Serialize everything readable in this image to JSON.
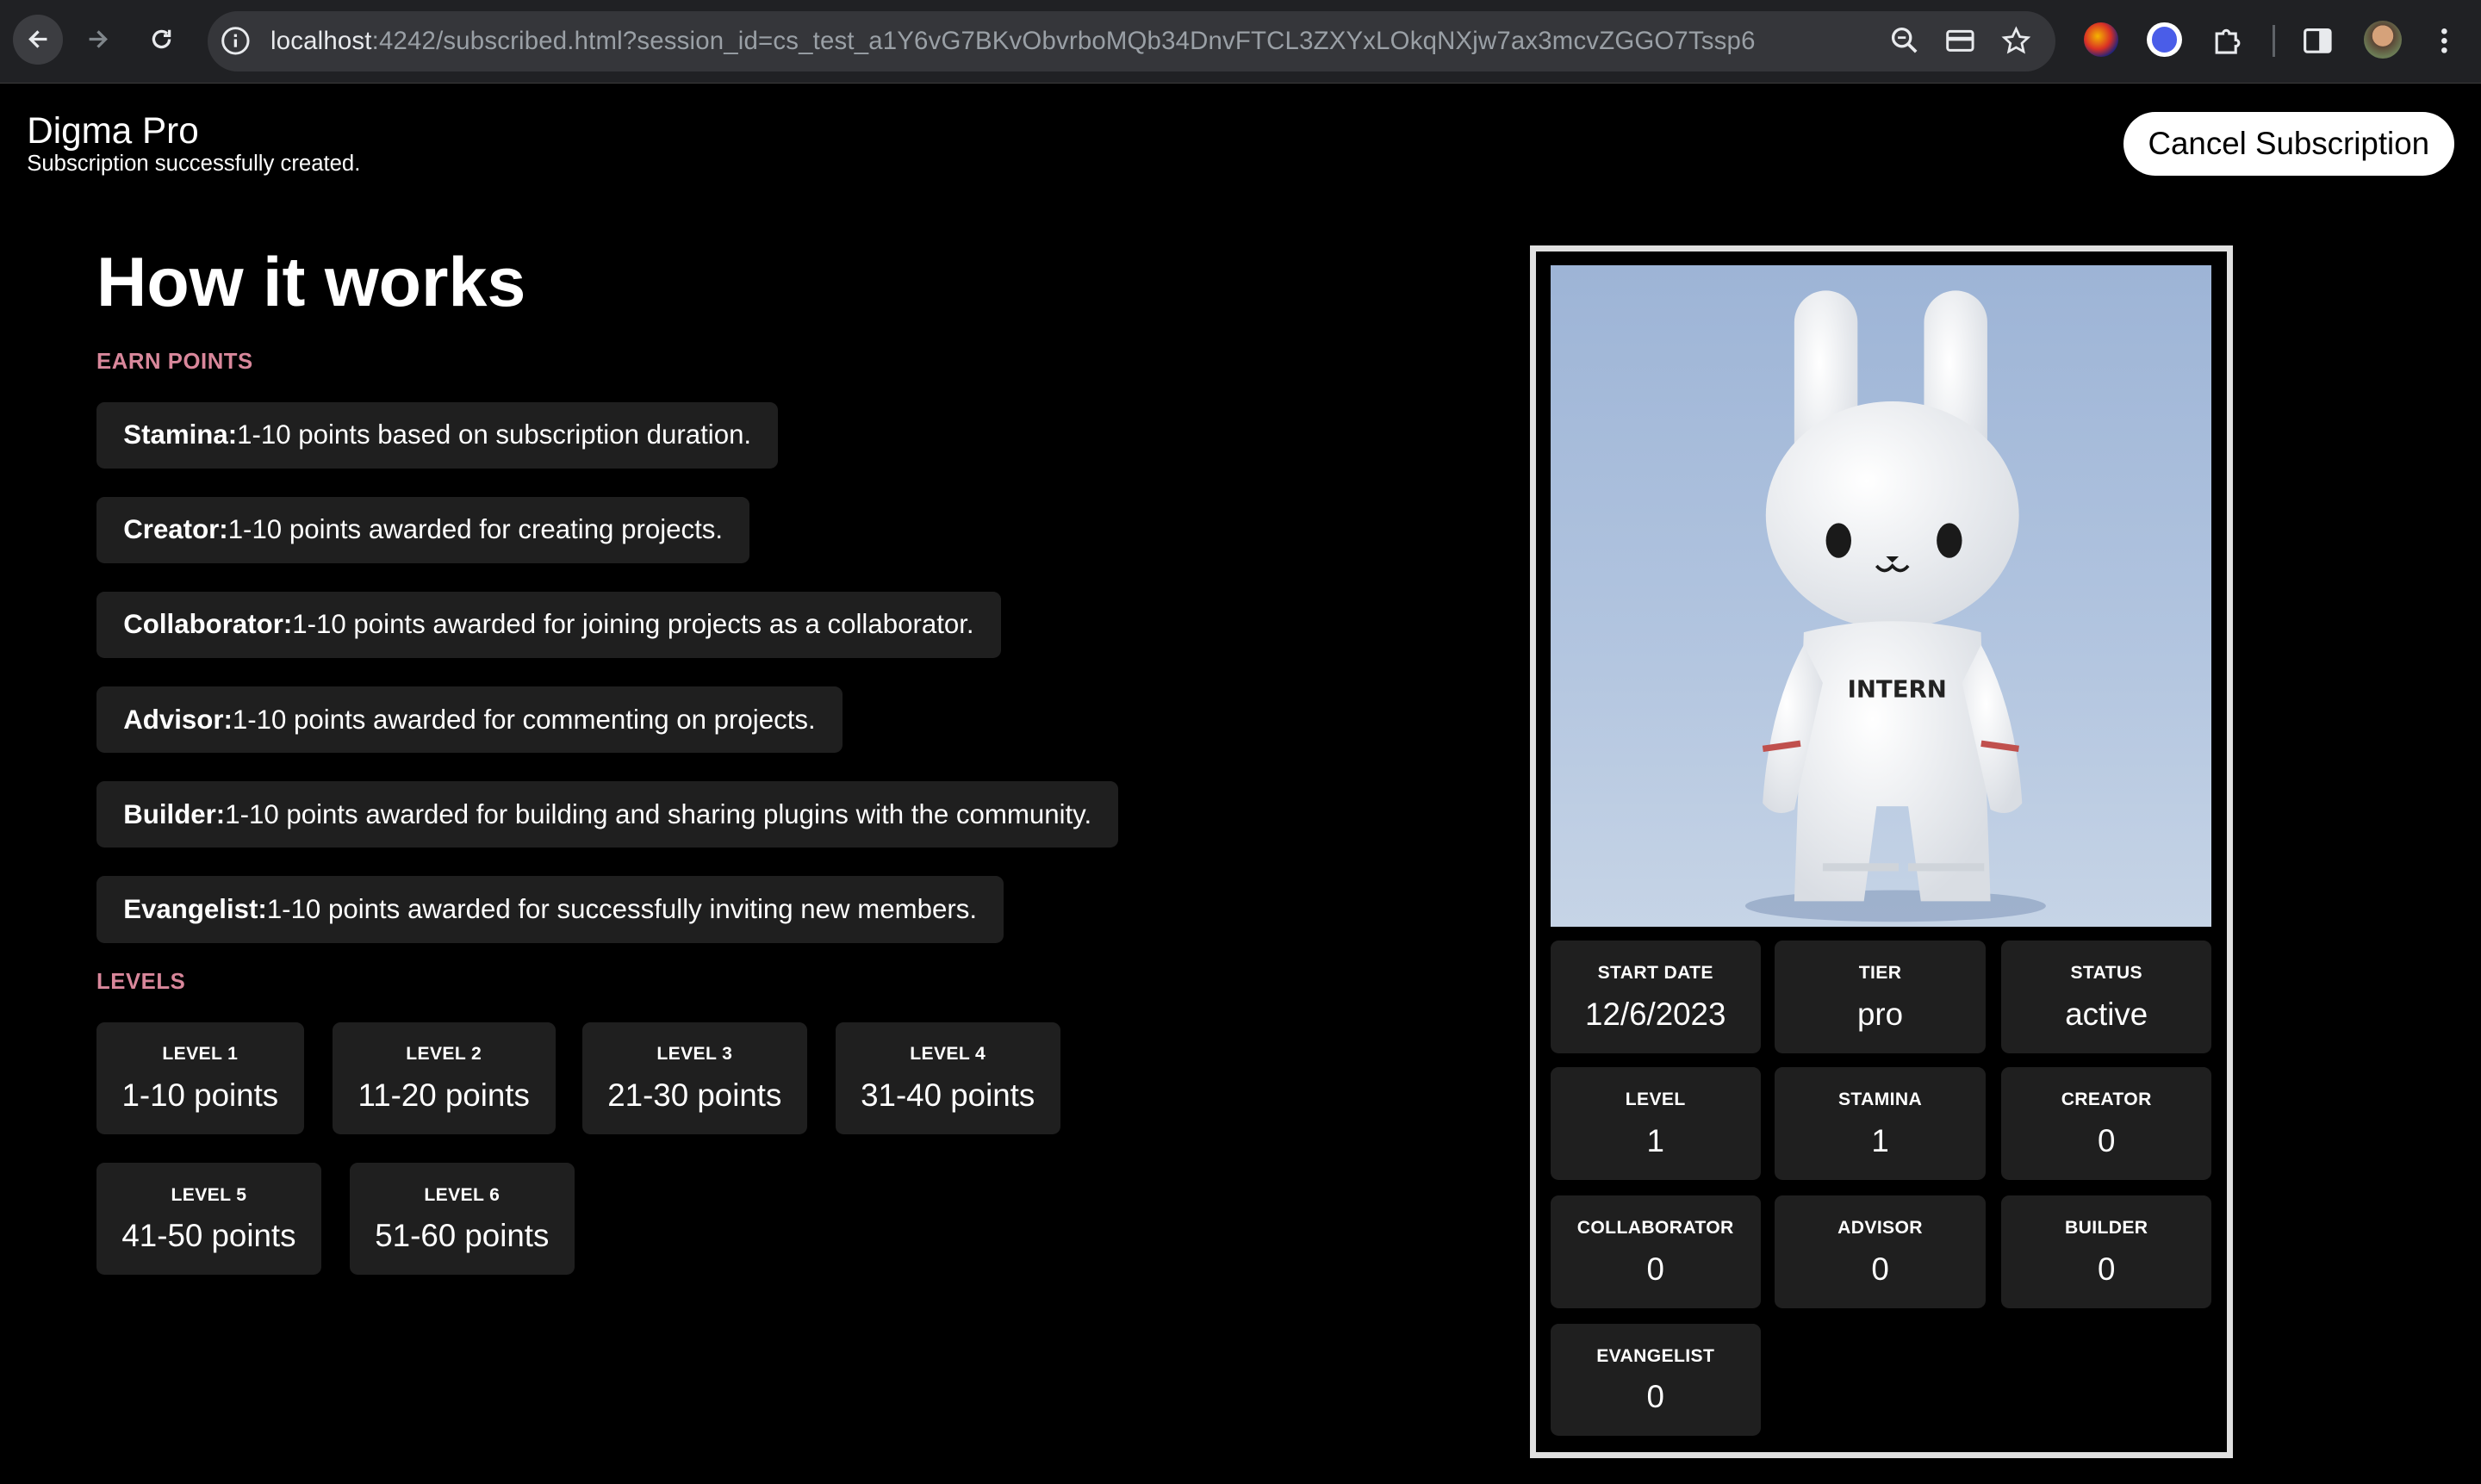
{
  "browser": {
    "url_host": "localhost",
    "url_rest": ":4242/subscribed.html?session_id=cs_test_a1Y6vG7BKvObvrboMQb34DnvFTCL3ZXYxLOkqNXjw7ax3mcvZGGO7Tssp6"
  },
  "header": {
    "title": "Digma Pro",
    "subtitle": "Subscription successfully created.",
    "cancel_label": "Cancel Subscription"
  },
  "how": {
    "title": "How it works",
    "earn_label": "EARN POINTS",
    "levels_label": "LEVELS",
    "points": [
      {
        "name": "Stamina:",
        "desc": "1-10 points based on subscription duration."
      },
      {
        "name": "Creator:",
        "desc": "1-10 points awarded for creating projects."
      },
      {
        "name": "Collaborator:",
        "desc": "1-10 points awarded for joining projects as a collaborator."
      },
      {
        "name": "Advisor:",
        "desc": "1-10 points awarded for commenting on projects."
      },
      {
        "name": "Builder:",
        "desc": "1-10 points awarded for building and sharing plugins with the community."
      },
      {
        "name": "Evangelist:",
        "desc": "1-10 points awarded for successfully inviting new members."
      }
    ],
    "levels": [
      {
        "label": "LEVEL 1",
        "points": "1-10 points"
      },
      {
        "label": "LEVEL 2",
        "points": "11-20 points"
      },
      {
        "label": "LEVEL 3",
        "points": "21-30 points"
      },
      {
        "label": "LEVEL 4",
        "points": "31-40 points"
      },
      {
        "label": "LEVEL 5",
        "points": "41-50 points"
      },
      {
        "label": "LEVEL 6",
        "points": "51-60 points"
      }
    ]
  },
  "card": {
    "badge_text": "INTERN",
    "stats": [
      {
        "key": "START DATE",
        "value": "12/6/2023"
      },
      {
        "key": "TIER",
        "value": "pro"
      },
      {
        "key": "STATUS",
        "value": "active"
      },
      {
        "key": "LEVEL",
        "value": "1"
      },
      {
        "key": "STAMINA",
        "value": "1"
      },
      {
        "key": "CREATOR",
        "value": "0"
      },
      {
        "key": "COLLABORATOR",
        "value": "0"
      },
      {
        "key": "ADVISOR",
        "value": "0"
      },
      {
        "key": "BUILDER",
        "value": "0"
      },
      {
        "key": "EVANGELIST",
        "value": "0"
      }
    ]
  }
}
